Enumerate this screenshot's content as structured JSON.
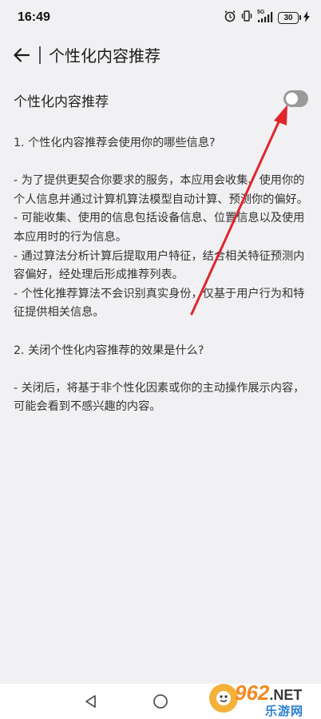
{
  "status_bar": {
    "time": "16:49",
    "network": "5G",
    "battery": "30",
    "icons": [
      "alarm-icon",
      "vibrate-icon",
      "signal-icon",
      "charging-icon"
    ]
  },
  "header": {
    "title": "个性化内容推荐",
    "back_icon": "arrow-left-icon"
  },
  "setting": {
    "label": "个性化内容推荐",
    "enabled": false
  },
  "content": {
    "q1": "1. 个性化内容推荐会使用你的哪些信息?",
    "q1_items": [
      "- 为了提供更契合你要求的服务，本应用会收集、使用你的个人信息并通过计算机算法模型自动计算、预测你的偏好。",
      "- 可能收集、使用的信息包括设备信息、位置信息以及使用本应用时的行为信息。",
      "- 通过算法分析计算后提取用户特征，结合相关特征预测内容偏好，经处理后形成推荐列表。",
      "- 个性化推荐算法不会识别真实身份，仅基于用户行为和特征提供相关信息。"
    ],
    "q2": "2. 关闭个性化内容推荐的效果是什么?",
    "q2_items": [
      "- 关闭后，将基于非个性化因素或你的主动操作展示内容，可能会看到不感兴趣的内容。"
    ]
  },
  "annotation": {
    "color": "#e0252b"
  },
  "nav_bar": {
    "icons": [
      "nav-back-icon",
      "nav-home-icon"
    ]
  },
  "watermark": {
    "logo_number": "962",
    "logo_suffix": ".NET",
    "site_name": "乐游网"
  }
}
